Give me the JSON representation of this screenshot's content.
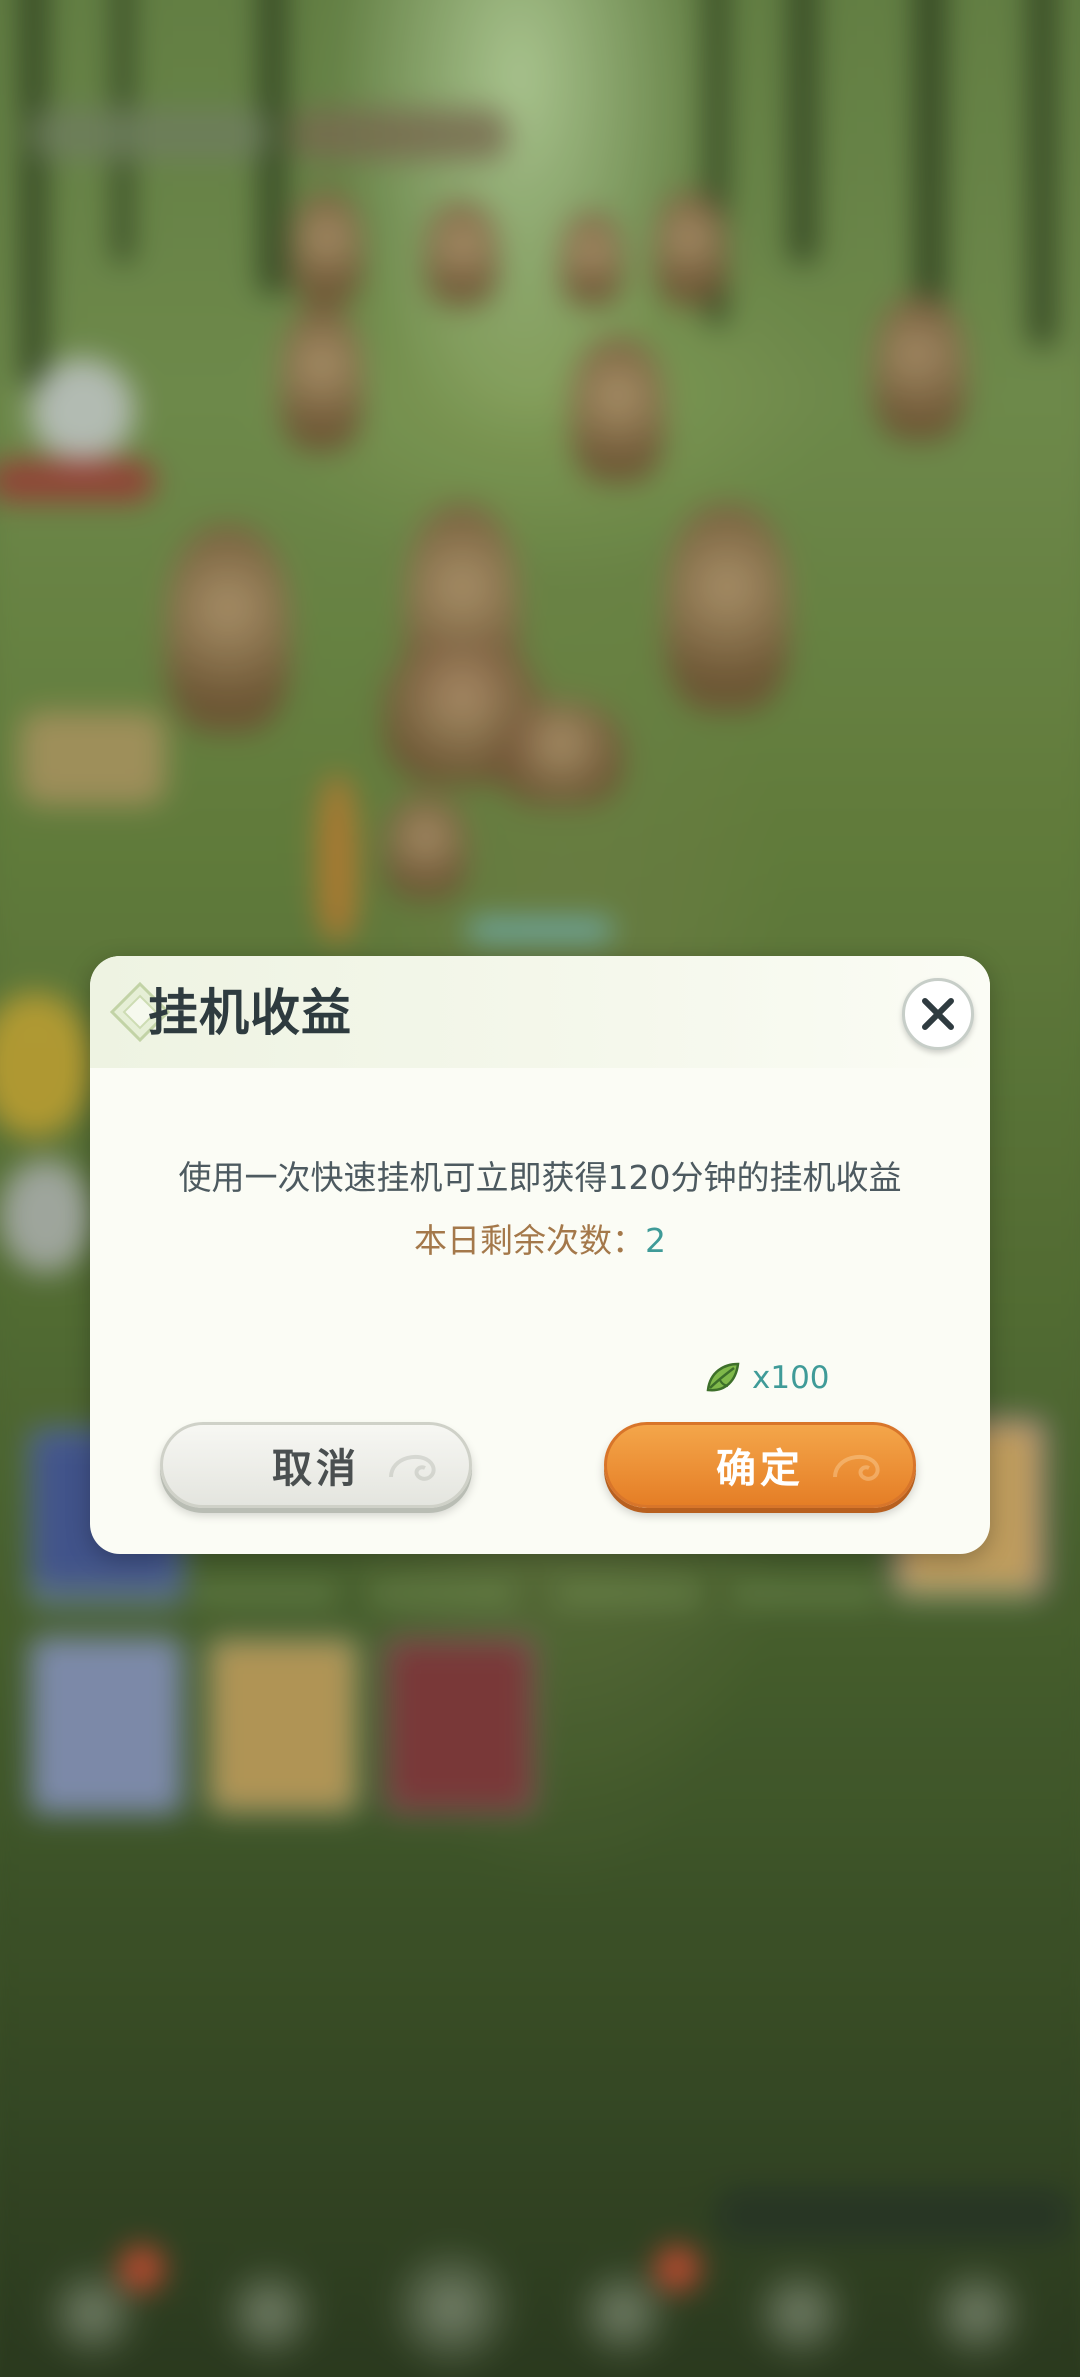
{
  "dialog": {
    "title": "挂机收益",
    "message": "使用一次快速挂机可立即获得120分钟的挂机收益",
    "remaining_label": "本日剩余次数：",
    "remaining_count": "2",
    "cost": {
      "icon": "leaf-icon",
      "quantity": "x100"
    },
    "cancel_label": "取消",
    "confirm_label": "确定",
    "close_icon": "close-icon"
  },
  "colors": {
    "title": "#2e3b3f",
    "message": "#4d5a60",
    "remaining_label": "#a4784a",
    "accent_teal": "#3f9b98",
    "confirm_button": "#e57e26",
    "cancel_button": "#e4e5df",
    "dialog_bg": "#fbfcf5"
  }
}
